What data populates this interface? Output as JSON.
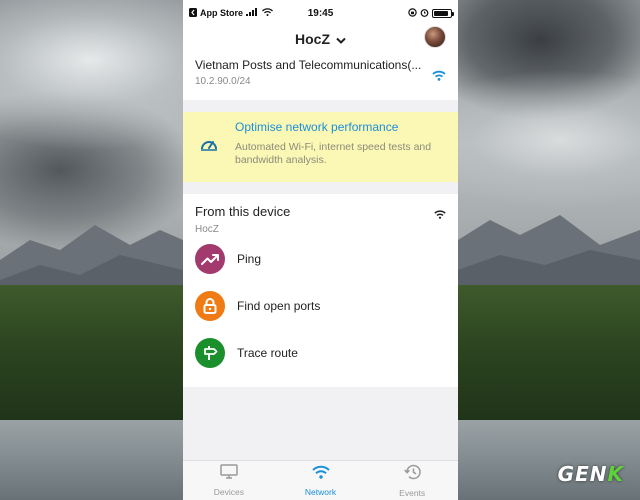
{
  "statusbar": {
    "back_label": "App Store",
    "time": "19:45",
    "battery_level": 0.85
  },
  "header": {
    "title": "HocZ"
  },
  "network": {
    "name": "Vietnam Posts and Telecommunications(...",
    "subnet": "10.2.90.0/24"
  },
  "promo": {
    "title": "Optimise network performance",
    "description": "Automated Wi-Fi, internet speed tests and bandwidth analysis."
  },
  "tools": {
    "heading": "From this device",
    "device_name": "HocZ",
    "items": [
      {
        "label": "Ping",
        "icon": "trend-up-icon",
        "color": "#a23a6e"
      },
      {
        "label": "Find open ports",
        "icon": "lock-icon",
        "color": "#f07a14"
      },
      {
        "label": "Trace route",
        "icon": "signpost-icon",
        "color": "#1b8f2c"
      }
    ]
  },
  "tabbar": {
    "tabs": [
      {
        "label": "Devices",
        "icon": "monitor-icon",
        "active": false
      },
      {
        "label": "Network",
        "icon": "wifi-icon",
        "active": true
      },
      {
        "label": "Events",
        "icon": "history-icon",
        "active": false
      }
    ]
  },
  "colors": {
    "accent": "#1a8fd8",
    "promo_bg": "#fbf7b5"
  },
  "watermark": {
    "text_main": "GEN",
    "text_accent": "K"
  }
}
